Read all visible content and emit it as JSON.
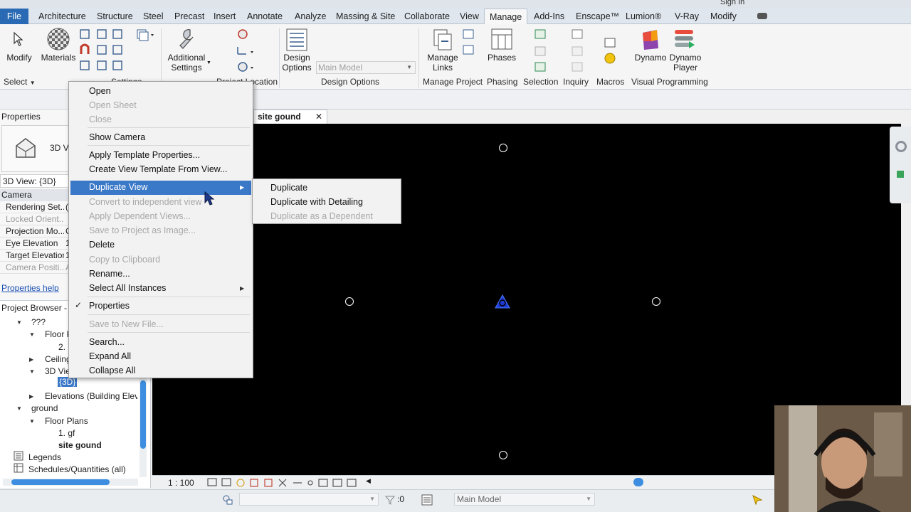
{
  "title_strip": {
    "sign_in": "Sign In"
  },
  "tabs": [
    "File",
    "Architecture",
    "Structure",
    "Steel",
    "Precast",
    "Insert",
    "Annotate",
    "Analyze",
    "Massing & Site",
    "Collaborate",
    "View",
    "Manage",
    "Add-Ins",
    "Enscape™",
    "Lumion®",
    "V-Ray",
    "Modify"
  ],
  "active_tab": "Manage",
  "ribbon": {
    "modify": "Modify",
    "materials": "Materials",
    "additional_settings_1": "Additional",
    "additional_settings_2": "Settings",
    "design_options_1": "Design",
    "design_options_2": "Options",
    "main_model_select": "Main Model",
    "manage_links_1": "Manage",
    "manage_links_2": "Links",
    "phases": "Phases",
    "dynamo": "Dynamo",
    "dynamo_player_1": "Dynamo",
    "dynamo_player_2": "Player",
    "panels": {
      "select": "Select",
      "settings": "Settings",
      "project_location": "Project Location",
      "design_options": "Design Options",
      "manage_project": "Manage Project",
      "phasing": "Phasing",
      "selection": "Selection",
      "inquiry": "Inquiry",
      "macros": "Macros",
      "visual_programming": "Visual Programming"
    }
  },
  "properties": {
    "title": "Properties",
    "type_label": "3D Vi",
    "selector": "3D View: {3D}",
    "category": "Camera",
    "rows": [
      {
        "k": "Rendering Set...",
        "v": "(",
        "dim": false
      },
      {
        "k": "Locked Orient...",
        "v": "",
        "dim": true
      },
      {
        "k": "Projection Mo...",
        "v": "C",
        "dim": false
      },
      {
        "k": "Eye Elevation",
        "v": "1",
        "dim": false
      },
      {
        "k": "Target Elevation",
        "v": "1",
        "dim": false
      },
      {
        "k": "Camera Positi...",
        "v": "A",
        "dim": true
      }
    ],
    "help_link": "Properties help"
  },
  "browser": {
    "title": "Project Browser - P",
    "items": [
      {
        "text": "???",
        "indent": 1,
        "twisty": "▼"
      },
      {
        "text": "Floor P",
        "indent": 2,
        "twisty": "▼"
      },
      {
        "text": "2.",
        "indent": 3,
        "twisty": ""
      },
      {
        "text": "Ceiling",
        "indent": 2,
        "twisty": "▶"
      },
      {
        "text": "3D Vie",
        "indent": 2,
        "twisty": "▼"
      },
      {
        "text": "{3D}",
        "indent": 3,
        "twisty": "",
        "selected": true
      },
      {
        "text": "Elevations (Building Eleva",
        "indent": 2,
        "twisty": "▶"
      },
      {
        "text": "ground",
        "indent": 1,
        "twisty": "▼"
      },
      {
        "text": "Floor Plans",
        "indent": 2,
        "twisty": "▼"
      },
      {
        "text": "1. gf",
        "indent": 3,
        "twisty": ""
      },
      {
        "text": "site gound",
        "indent": 3,
        "twisty": "",
        "bold": true
      },
      {
        "text": "Legends",
        "indent": 0,
        "twisty": ""
      },
      {
        "text": "Schedules/Quantities (all)",
        "indent": 0,
        "twisty": ""
      }
    ]
  },
  "view_tab": {
    "label": "site gound",
    "close": "✕"
  },
  "view_control": {
    "scale": "1 : 100"
  },
  "status": {
    "selection_count": ":0",
    "workset": "Main Model"
  },
  "context_menu": [
    {
      "label": "Open",
      "disabled": false
    },
    {
      "label": "Open Sheet",
      "disabled": true
    },
    {
      "label": "Close",
      "disabled": true
    },
    {
      "label": "Show Camera",
      "disabled": false
    },
    {
      "label": "Apply Template Properties...",
      "disabled": false
    },
    {
      "label": "Create View Template From View...",
      "disabled": false
    },
    {
      "label": "Duplicate View",
      "disabled": false,
      "highlighted": true
    },
    {
      "label": "Convert to independent view",
      "disabled": true
    },
    {
      "label": "Apply Dependent Views...",
      "disabled": true
    },
    {
      "label": "Save to Project as Image...",
      "disabled": true
    },
    {
      "label": "Delete",
      "disabled": false
    },
    {
      "label": "Copy to Clipboard",
      "disabled": true
    },
    {
      "label": "Rename...",
      "disabled": false
    },
    {
      "label": "Select All Instances",
      "disabled": false
    },
    {
      "label": "Properties",
      "disabled": false,
      "checked": true
    },
    {
      "label": "Save to New File...",
      "disabled": true
    },
    {
      "label": "Search...",
      "disabled": false
    },
    {
      "label": "Expand All",
      "disabled": false
    },
    {
      "label": "Collapse All",
      "disabled": false
    }
  ],
  "submenu": [
    {
      "label": "Duplicate",
      "disabled": false
    },
    {
      "label": "Duplicate with Detailing",
      "disabled": false
    },
    {
      "label": "Duplicate as a Dependent",
      "disabled": true
    }
  ],
  "colors": {
    "accent": "#3a78c8",
    "file_tab": "#2a6ab4",
    "viewport": "#000000",
    "link": "#1a4fb4"
  }
}
